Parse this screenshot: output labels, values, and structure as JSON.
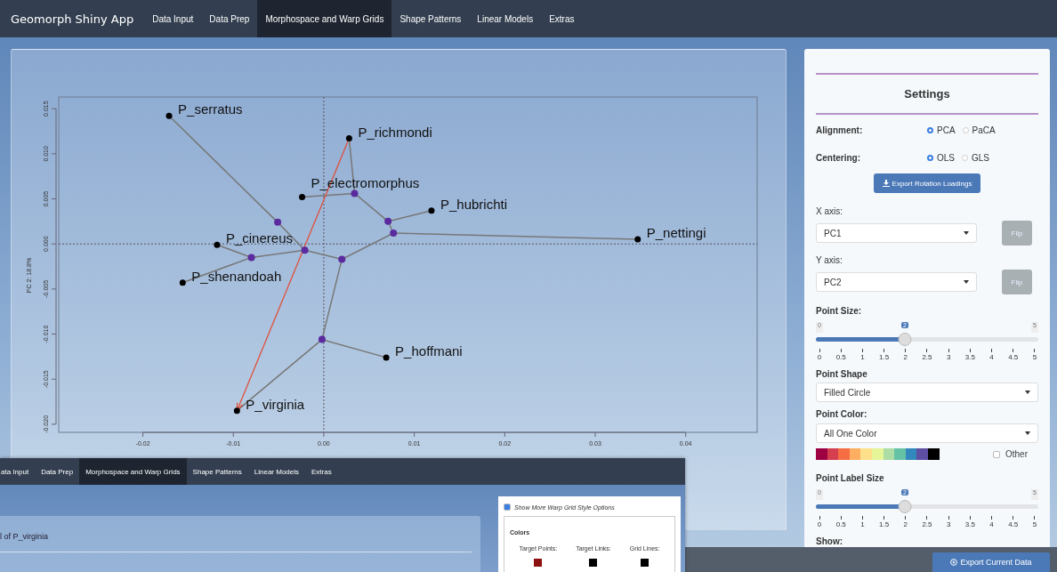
{
  "navbar": {
    "title": "Geomorph Shiny App",
    "tabs": [
      {
        "label": "Data Input",
        "selected": false
      },
      {
        "label": "Data Prep",
        "selected": false
      },
      {
        "label": "Morphospace and Warp Grids",
        "selected": true
      },
      {
        "label": "Shape Patterns",
        "selected": false
      },
      {
        "label": "Linear Models",
        "selected": false
      },
      {
        "label": "Extras",
        "selected": false
      }
    ]
  },
  "plot": {
    "chart_data": {
      "type": "scatter",
      "ylabel": "PC 2: 18.8%",
      "xlim": [
        -0.0293,
        0.0479
      ],
      "ylim": [
        -0.0209,
        0.0163
      ],
      "xticks": [
        {
          "value": -0.02,
          "label": "-0.02"
        },
        {
          "value": -0.01,
          "label": "-0.01"
        },
        {
          "value": 0,
          "label": "0.00"
        },
        {
          "value": 0.01,
          "label": "0.01"
        },
        {
          "value": 0.02,
          "label": "0.02"
        },
        {
          "value": 0.03,
          "label": "0.03"
        },
        {
          "value": 0.04,
          "label": "0.04"
        }
      ],
      "yticks": [
        {
          "value": 0.015,
          "label": "0.015"
        },
        {
          "value": 0.01,
          "label": "0.010"
        },
        {
          "value": 0.005,
          "label": "0.005"
        },
        {
          "value": 0,
          "label": "0.000"
        },
        {
          "value": -0.005,
          "label": "-0.005"
        },
        {
          "value": -0.01,
          "label": "-0.010"
        },
        {
          "value": -0.015,
          "label": "-0.015"
        },
        {
          "value": -0.02,
          "label": "-0.020"
        }
      ],
      "series": [
        {
          "color": "#000000",
          "x": [
            -0.0171,
            0.0028,
            -0.0024,
            0.0119,
            0.0347,
            -0.0118,
            -0.0156,
            0.0069,
            -0.0096
          ],
          "values": [
            0.0142,
            0.0117,
            0.0052,
            0.0037,
            0.0005,
            -0.0001,
            -0.0043,
            -0.0126,
            -0.0185
          ]
        },
        {
          "color": "#5b2a9e",
          "x": [
            -0.0051,
            0.0034,
            0.0071,
            0.0077,
            -0.008,
            -0.0021,
            0.002,
            -0.0002
          ],
          "values": [
            0.0024,
            0.0056,
            0.0025,
            0.0012,
            -0.0015,
            -0.0007,
            -0.0017,
            -0.0106
          ]
        },
        {
          "type": "line",
          "color": "#777777",
          "x": [
            -0.0171,
            -0.0051,
            -0.0021,
            -0.008,
            -0.0118,
            null,
            -0.008,
            -0.0156,
            null,
            -0.0021,
            0.002,
            0.0077,
            0.0347,
            null,
            0.002,
            -0.0002,
            0.0069,
            null,
            -0.0002,
            -0.0096,
            null,
            0.0028,
            0.0034,
            0.0071,
            0.0119,
            null,
            -0.0024,
            0.0034,
            null,
            0.0071,
            0.0077
          ],
          "values": [
            0.0142,
            0.0024,
            -0.0007,
            -0.0015,
            -0.0001,
            null,
            -0.0015,
            -0.0043,
            null,
            -0.0007,
            -0.0017,
            0.0012,
            0.0005,
            null,
            -0.0017,
            -0.0106,
            -0.0126,
            null,
            -0.0106,
            -0.0185,
            null,
            0.0117,
            0.0056,
            0.0025,
            0.0037,
            null,
            0.0052,
            0.0056,
            null,
            0.0025,
            0.0012
          ]
        },
        {
          "type": "line",
          "color": "#e0503c",
          "x": [
            0.0028,
            -0.0096
          ],
          "values": [
            0.0117,
            -0.0185
          ]
        }
      ],
      "annotations": [
        "P_serratus",
        "P_richmondi",
        "P_electromorphus",
        "P_hubrichti",
        "P_nettingi",
        "P_cinereus",
        "P_shenandoah",
        "P_hoffmani",
        "P_virginia"
      ]
    }
  },
  "settings": {
    "title": "Settings",
    "radio_groups": [
      {
        "label": "Alignment:",
        "options": [
          {
            "label": "PCA",
            "selected": true
          },
          {
            "label": "PaCA",
            "selected": false
          }
        ]
      },
      {
        "label": "Centering:",
        "options": [
          {
            "label": "OLS",
            "selected": true
          },
          {
            "label": "GLS",
            "selected": false
          }
        ]
      }
    ],
    "export_button": "Export Rotation Loadings",
    "axes": [
      {
        "label": "X axis:",
        "value": "PC1",
        "button": "Flip"
      },
      {
        "label": "Y axis:",
        "value": "PC2",
        "button": "Flip"
      }
    ],
    "point_size": {
      "label": "Point Size:",
      "min": "0",
      "max": "5",
      "value": "2",
      "level": 0.4,
      "ticks": [
        "0",
        "0.5",
        "1",
        "1.5",
        "2",
        "2.5",
        "3",
        "3.5",
        "4",
        "4.5",
        "5"
      ]
    },
    "point_shape": {
      "label": "Point Shape",
      "value": "Filled Circle"
    },
    "point_color": {
      "label": "Point Color:",
      "value": "All One Color",
      "palette": [
        {
          "color": "#9e0142"
        },
        {
          "color": "#d53e4f"
        },
        {
          "color": "#f46d43"
        },
        {
          "color": "#fdae61"
        },
        {
          "color": "#fee08b"
        },
        {
          "color": "#e6f598"
        },
        {
          "color": "#abdda4"
        },
        {
          "color": "#66c2a5"
        },
        {
          "color": "#3288bd"
        },
        {
          "color": "#5e4fa2"
        },
        {
          "color": "#000000"
        }
      ],
      "other": {
        "label": "Other",
        "checked": false
      }
    },
    "point_label_size": {
      "label": "Point Label Size",
      "min": "0",
      "max": "5",
      "value": "2",
      "level": 0.4,
      "ticks": [
        "0",
        "0.5",
        "1",
        "1.5",
        "2",
        "2.5",
        "3",
        "3.5",
        "4",
        "4.5",
        "5"
      ]
    },
    "show_label": "Show:"
  },
  "footer": {
    "export_button": "Export Current Data"
  },
  "overlay_window": {
    "tabs": [
      {
        "label": "ata Input",
        "selected": false
      },
      {
        "label": "Data Prep",
        "selected": false
      },
      {
        "label": "Morphospace and Warp Grids",
        "selected": true
      },
      {
        "label": "Shape Patterns",
        "selected": false
      },
      {
        "label": "Linear Models",
        "selected": false
      },
      {
        "label": "Extras",
        "selected": false
      }
    ],
    "panel_text": "l of P_virginia",
    "warp_options": {
      "label": "Show More Warp Grid Style Options",
      "checked": true
    },
    "colors": {
      "title": "Colors",
      "items": [
        {
          "label": "Target Points:",
          "color": "#8b1010"
        },
        {
          "label": "Target Links:",
          "color": "#000000"
        },
        {
          "label": "Grid Lines:",
          "color": "#000000"
        }
      ]
    }
  }
}
